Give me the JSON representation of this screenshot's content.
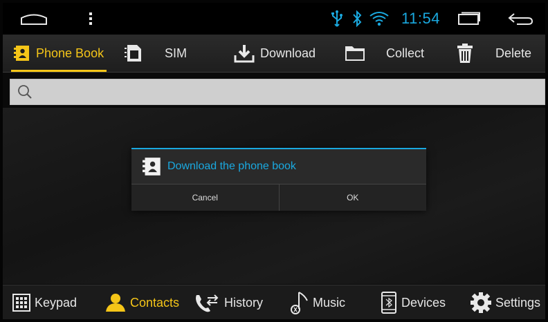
{
  "status_bar": {
    "time": "11:54",
    "icons": [
      "home-outline-icon",
      "overflow-menu-icon",
      "usb-icon",
      "bluetooth-icon",
      "wifi-icon",
      "recent-apps-icon",
      "back-icon"
    ],
    "accent": "#1aa9e0"
  },
  "toolbar": {
    "tabs": [
      {
        "label": "Phone Book",
        "icon": "phonebook-icon",
        "active": true
      },
      {
        "label": "SIM",
        "icon": "sim-card-icon"
      },
      {
        "label": "Download",
        "icon": "download-icon"
      },
      {
        "label": "Collect",
        "icon": "folder-icon"
      },
      {
        "label": "Delete",
        "icon": "trash-icon"
      }
    ],
    "active_color": "#f5c518"
  },
  "search": {
    "placeholder": "",
    "value": "",
    "icon": "search-icon"
  },
  "dialog": {
    "title": "Download the phone book",
    "icon": "phonebook-icon",
    "cancel_label": "Cancel",
    "ok_label": "OK"
  },
  "bottom_nav": {
    "items": [
      {
        "label": "Keypad",
        "icon": "keypad-icon"
      },
      {
        "label": "Contacts",
        "icon": "contacts-icon",
        "active": true
      },
      {
        "label": "History",
        "icon": "call-history-icon"
      },
      {
        "label": "Music",
        "icon": "music-note-icon"
      },
      {
        "label": "Devices",
        "icon": "devices-icon"
      },
      {
        "label": "Settings",
        "icon": "settings-icon"
      }
    ]
  }
}
